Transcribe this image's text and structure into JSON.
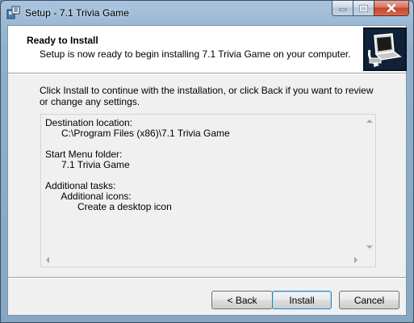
{
  "window": {
    "title": "Setup - 7.1 Trivia Game"
  },
  "icons": {
    "app": "setup-app-icon",
    "header": "installer-computer-icon",
    "minimize": "minimize-icon",
    "maximize": "maximize-icon",
    "close": "close-icon"
  },
  "header": {
    "title": "Ready to Install",
    "subtitle": "Setup is now ready to begin installing 7.1 Trivia Game on your computer."
  },
  "intro": "Click Install to continue with the installation, or click Back if you want to review or change any settings.",
  "summary": {
    "lines": [
      "Destination location:",
      "      C:\\Program Files (x86)\\7.1 Trivia Game",
      "",
      "Start Menu folder:",
      "      7.1 Trivia Game",
      "",
      "Additional tasks:",
      "      Additional icons:",
      "            Create a desktop icon"
    ]
  },
  "buttons": {
    "back": "< Back",
    "install": "Install",
    "cancel": "Cancel"
  },
  "colors": {
    "title_bar": "#9ab8d4",
    "close_button": "#c4452b",
    "default_button_border": "#3c7fb1"
  }
}
